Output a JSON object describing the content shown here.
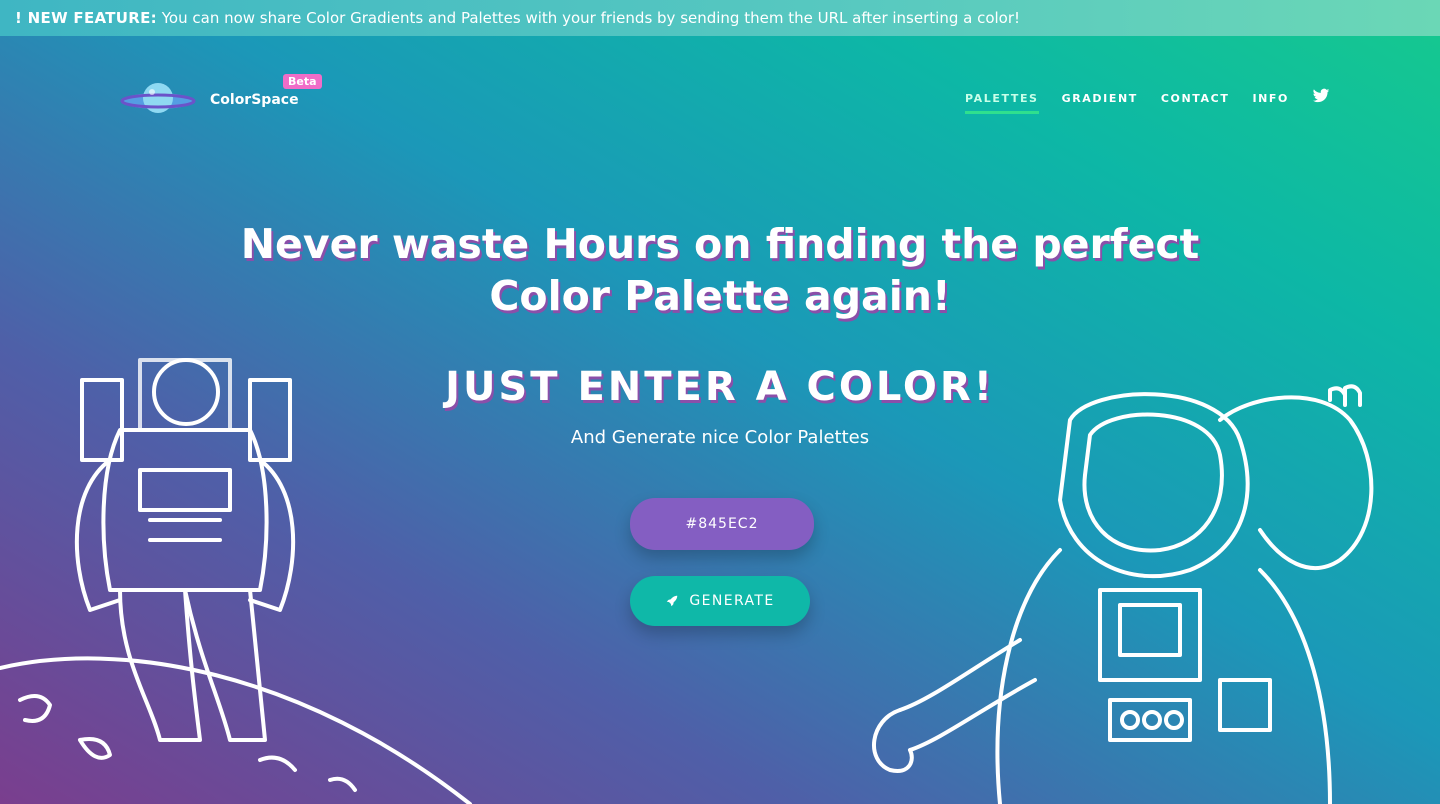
{
  "banner": {
    "strong": "! NEW FEATURE:",
    "text": " You can now share Color Gradients and Palettes with your friends by sending them the URL after inserting a color!"
  },
  "logo": {
    "brand": "ColorSpace",
    "beta": "Beta"
  },
  "nav": {
    "items": [
      "PALETTES",
      "GRADIENT",
      "CONTACT",
      "INFO"
    ],
    "active": "PALETTES",
    "icon": "twitter-icon"
  },
  "hero": {
    "headline_line1": "Never waste Hours on finding the perfect",
    "headline_line2": "Color Palette again!",
    "subheadline": "JUST ENTER A COLOR!",
    "tagline": "And Generate nice Color Palettes"
  },
  "form": {
    "color_value": "#845EC2",
    "generate_label": "GENERATE",
    "generate_icon": "rocket-icon"
  },
  "colors": {
    "accent": "#2fe08e",
    "input_bg": "#845EC2",
    "button_bg": "#0fb8a8",
    "beta_badge": "#f06dc8"
  }
}
